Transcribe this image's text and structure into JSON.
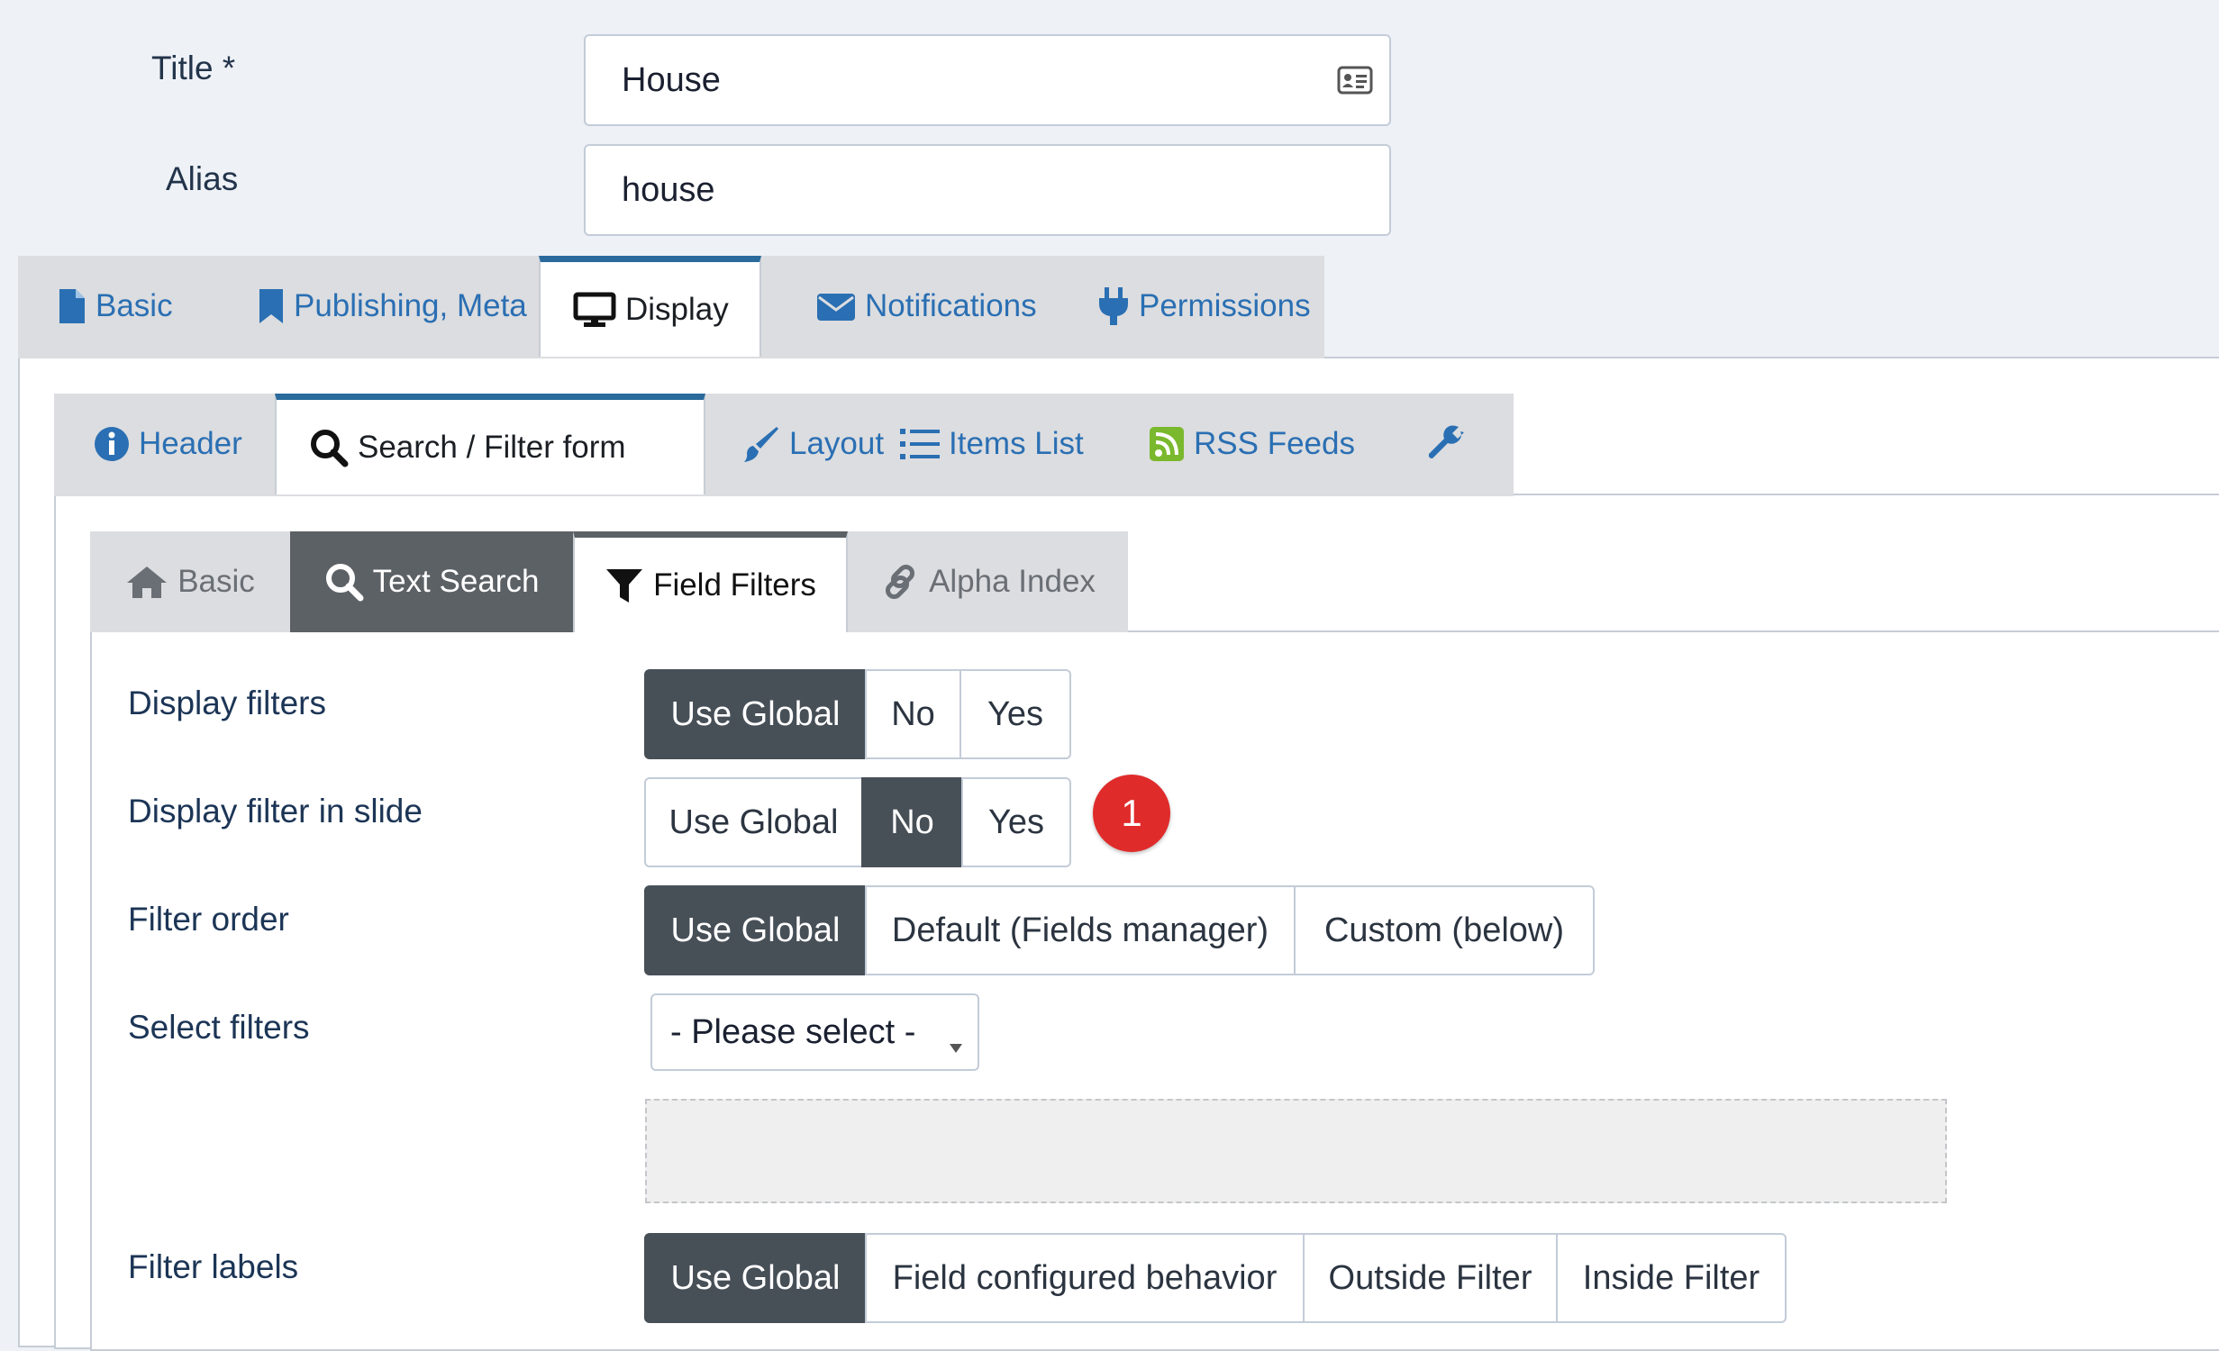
{
  "form": {
    "title_label": "Title *",
    "title_value": "House",
    "alias_label": "Alias",
    "alias_value": "house"
  },
  "main_tabs": [
    {
      "label": "Basic",
      "icon": "file-icon",
      "active": false
    },
    {
      "label": "Publishing, Meta",
      "icon": "bookmark-icon",
      "active": false
    },
    {
      "label": "Display",
      "icon": "monitor-icon",
      "active": true
    },
    {
      "label": "Notifications",
      "icon": "envelope-icon",
      "active": false
    },
    {
      "label": "Permissions",
      "icon": "plug-icon",
      "active": false
    }
  ],
  "sub_tabs": [
    {
      "label": "Header",
      "icon": "info-icon",
      "active": false
    },
    {
      "label": "Search / Filter form",
      "icon": "search-icon",
      "active": true
    },
    {
      "label": "Layout",
      "icon": "brush-icon",
      "active": false
    },
    {
      "label": "Items List",
      "icon": "list-icon",
      "active": false
    },
    {
      "label": "RSS Feeds",
      "icon": "rss-icon",
      "active": false
    },
    {
      "label": "",
      "icon": "wrench-icon",
      "active": false
    }
  ],
  "filter_tabs": [
    {
      "label": "Basic",
      "icon": "home-icon",
      "state": "inactive"
    },
    {
      "label": "Text Search",
      "icon": "search-icon",
      "state": "dark"
    },
    {
      "label": "Field Filters",
      "icon": "funnel-icon",
      "state": "active"
    },
    {
      "label": "Alpha Index",
      "icon": "link-icon",
      "state": "inactive"
    }
  ],
  "rows": {
    "display_filters": {
      "label": "Display filters",
      "options": [
        "Use Global",
        "No",
        "Yes"
      ],
      "selected": "Use Global"
    },
    "display_filter_in_slide": {
      "label": "Display filter in slide",
      "options": [
        "Use Global",
        "No",
        "Yes"
      ],
      "selected": "No",
      "badge": "1"
    },
    "filter_order": {
      "label": "Filter order",
      "options": [
        "Use Global",
        "Default (Fields manager)",
        "Custom (below)"
      ],
      "selected": "Use Global"
    },
    "select_filters": {
      "label": "Select filters",
      "value": "- Please select -"
    },
    "filter_labels": {
      "label": "Filter labels",
      "options": [
        "Use Global",
        "Field configured behavior",
        "Outside Filter",
        "Inside Filter"
      ],
      "selected": "Use Global"
    }
  },
  "colors": {
    "accent": "#2a6fb3",
    "active_bar": "#2a6a9c",
    "selected_segment": "#474f57",
    "badge": "#e02b2b"
  }
}
